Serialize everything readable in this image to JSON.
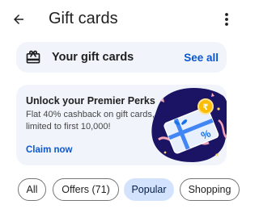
{
  "header": {
    "title": "Gift cards",
    "back_icon": "arrow-back-icon",
    "more_icon": "more-vert-icon"
  },
  "gift_cards_row": {
    "icon": "gift-card-icon",
    "label": "Your gift cards",
    "link": "See all"
  },
  "promo": {
    "title": "Unlock your Premier Perks",
    "description": "Flat 40% cashback on gift cards, limited to first 10,000!",
    "cta": "Claim now",
    "art": {
      "badge_symbol": "₹",
      "card_symbol": "%"
    }
  },
  "filters": {
    "chips": [
      {
        "label": "All",
        "selected": false
      },
      {
        "label": "Offers (71)",
        "selected": false
      },
      {
        "label": "Popular",
        "selected": true
      },
      {
        "label": "Shopping",
        "selected": false
      }
    ]
  },
  "colors": {
    "accent": "#0b57d0",
    "surface": "#f1f4fb",
    "chip_selected": "#d3e3fd",
    "art_background": "#1b1464"
  }
}
